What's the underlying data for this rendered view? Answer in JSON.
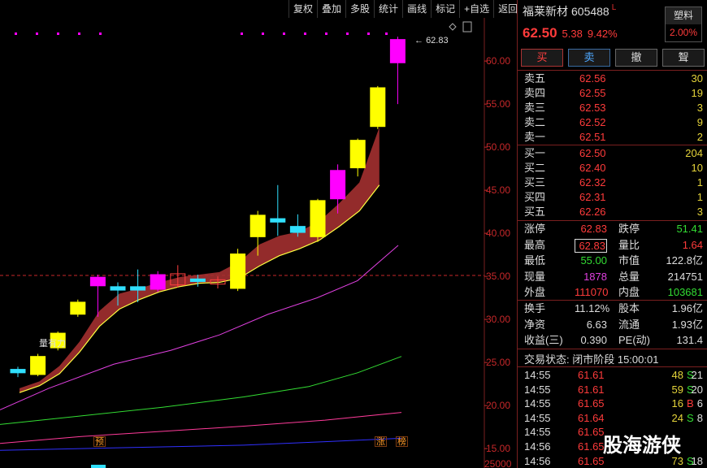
{
  "toolbar": [
    "复权",
    "叠加",
    "多股",
    "统计",
    "画线",
    "标记",
    "+自选",
    "返回"
  ],
  "stock": {
    "name": "福莱新材",
    "code": "605488",
    "flag": "L",
    "price": "62.50",
    "change": "5.38",
    "pct": "9.42%",
    "tag_top": "塑料",
    "tag_bottom": "2.00%"
  },
  "actions": [
    "买",
    "卖",
    "撤",
    "聟"
  ],
  "asks": [
    {
      "label": "卖五",
      "price": "62.56",
      "vol": "30"
    },
    {
      "label": "卖四",
      "price": "62.55",
      "vol": "19"
    },
    {
      "label": "卖三",
      "price": "62.53",
      "vol": "3"
    },
    {
      "label": "卖二",
      "price": "62.52",
      "vol": "9"
    },
    {
      "label": "卖一",
      "price": "62.51",
      "vol": "2"
    }
  ],
  "bids": [
    {
      "label": "买一",
      "price": "62.50",
      "vol": "204"
    },
    {
      "label": "买二",
      "price": "62.40",
      "vol": "10"
    },
    {
      "label": "买三",
      "price": "62.32",
      "vol": "1"
    },
    {
      "label": "买四",
      "price": "62.31",
      "vol": "1"
    },
    {
      "label": "买五",
      "price": "62.26",
      "vol": "3"
    }
  ],
  "quote1": [
    {
      "l1": "涨停",
      "v1": "62.83",
      "c1": "red",
      "l2": "跌停",
      "v2": "51.41",
      "c2": "green"
    },
    {
      "l1": "最高",
      "v1": "62.83",
      "c1": "red",
      "l2": "量比",
      "v2": "1.64",
      "c2": "red"
    },
    {
      "l1": "最低",
      "v1": "55.00",
      "c1": "green",
      "l2": "市值",
      "v2": "122.8亿",
      "c2": "white"
    },
    {
      "l1": "现量",
      "v1": "1878",
      "c1": "mag",
      "l2": "总量",
      "v2": "214751",
      "c2": "white"
    },
    {
      "l1": "外盘",
      "v1": "111070",
      "c1": "red",
      "l2": "内盘",
      "v2": "103681",
      "c2": "green"
    }
  ],
  "quote2": [
    {
      "l1": "换手",
      "v1": "11.12%",
      "l2": "股本",
      "v2": "1.96亿"
    },
    {
      "l1": "净资",
      "v1": "6.63",
      "l2": "流通",
      "v2": "1.93亿"
    },
    {
      "l1": "收益(三)",
      "v1": "0.390",
      "l2": "PE(动)",
      "v2": "131.4"
    }
  ],
  "status": "交易状态: 闭市阶段 15:00:01",
  "ticks": [
    {
      "time": "14:55",
      "price": "61.61",
      "vol": "48",
      "dir": "S",
      "cnt": "21"
    },
    {
      "time": "14:55",
      "price": "61.61",
      "vol": "59",
      "dir": "S",
      "cnt": "20"
    },
    {
      "time": "14:55",
      "price": "61.65",
      "vol": "16",
      "dir": "B",
      "cnt": "6"
    },
    {
      "time": "14:55",
      "price": "61.64",
      "vol": "24",
      "dir": "S",
      "cnt": "8"
    },
    {
      "time": "14:55",
      "price": "61.65",
      "vol": "",
      "dir": "",
      "cnt": ""
    },
    {
      "time": "14:56",
      "price": "61.65",
      "vol": "",
      "dir": "",
      "cnt": ""
    },
    {
      "time": "14:56",
      "price": "61.65",
      "vol": "73",
      "dir": "S",
      "cnt": "18"
    }
  ],
  "watermark": "股海游侠",
  "chart_data": {
    "type": "candlestick",
    "y_ticks": [
      "60.00",
      "55.00",
      "50.00",
      "45.00",
      "40.00",
      "35.00",
      "30.00",
      "25.00",
      "20.00",
      "15.00"
    ],
    "ylim": [
      13.5,
      64.2
    ],
    "dashed_level": 35.1,
    "max_label": "62.83",
    "indicator_label": "量有力",
    "markers": [
      "预",
      "涨",
      "榜"
    ],
    "bottom_label": "25000",
    "candles": [
      {
        "o": 23.8,
        "c": 24.2,
        "h": 24.5,
        "l": 23.3,
        "color": "#30e0ff"
      },
      {
        "o": 23.6,
        "c": 25.7,
        "h": 26.0,
        "l": 23.4,
        "color": "#ffff00"
      },
      {
        "o": 26.7,
        "c": 28.4,
        "h": 28.6,
        "l": 26.4,
        "color": "#ffff00"
      },
      {
        "o": 30.6,
        "c": 32.0,
        "h": 32.3,
        "l": 30.3,
        "color": "#ffff00"
      },
      {
        "o": 34.9,
        "c": 33.9,
        "h": 35.2,
        "l": 30.3,
        "color": "#ff00ff"
      },
      {
        "o": 33.8,
        "c": 33.4,
        "h": 34.3,
        "l": 31.6,
        "color": "#30e0ff"
      },
      {
        "o": 33.8,
        "c": 33.4,
        "h": 35.8,
        "l": 32.0,
        "color": "#30e0ff"
      },
      {
        "o": 35.2,
        "c": 33.5,
        "h": 35.6,
        "l": 33.2,
        "color": "#ff00ff"
      },
      {
        "o": 34.0,
        "c": 35.3,
        "h": 36.3,
        "l": 33.7,
        "color": "#ff4040",
        "hollow": true
      },
      {
        "o": 34.7,
        "c": 34.4,
        "h": 35.2,
        "l": 33.8,
        "color": "#30e0ff"
      },
      {
        "o": 34.6,
        "c": 34.1,
        "h": 35.0,
        "l": 33.6,
        "color": "#ff4040",
        "hollow": true
      },
      {
        "o": 33.6,
        "c": 37.6,
        "h": 38.2,
        "l": 33.3,
        "color": "#ffff00"
      },
      {
        "o": 39.6,
        "c": 42.1,
        "h": 42.6,
        "l": 37.4,
        "color": "#ffff00"
      },
      {
        "o": 41.7,
        "c": 41.3,
        "h": 45.6,
        "l": 39.7,
        "color": "#30e0ff"
      },
      {
        "o": 40.8,
        "c": 40.1,
        "h": 42.2,
        "l": 39.6,
        "color": "#30e0ff"
      },
      {
        "o": 39.6,
        "c": 43.8,
        "h": 44.0,
        "l": 39.0,
        "color": "#ffff00"
      },
      {
        "o": 44.0,
        "c": 47.3,
        "h": 48.0,
        "l": 42.3,
        "color": "#ff00ff"
      },
      {
        "o": 47.6,
        "c": 50.8,
        "h": 51.0,
        "l": 46.6,
        "color": "#ffff00"
      },
      {
        "o": 52.4,
        "c": 56.9,
        "h": 57.1,
        "l": 52.1,
        "color": "#ffff00"
      },
      {
        "o": 59.8,
        "c": 62.5,
        "h": 62.83,
        "l": 55.0,
        "color": "#ff00ff"
      }
    ],
    "ma_fast": [
      21.5,
      22.3,
      23.7,
      26.2,
      29.2,
      31.2,
      32.3,
      33.2,
      33.8,
      34.2,
      34.3,
      34.8,
      36.2,
      37.4,
      38.2,
      39.2,
      40.8,
      42.6,
      45.6
    ],
    "ma_fast2": [
      22.0,
      22.8,
      24.6,
      27.4,
      31.0,
      33.0,
      33.6,
      34.3,
      34.9,
      35.2,
      35.5,
      36.7,
      38.7,
      39.7,
      40.2,
      41.4,
      43.5,
      45.9,
      52.3
    ],
    "lines": [
      {
        "color": "#e040e0",
        "points": [
          [
            0,
            19.5
          ],
          [
            60,
            22.0
          ],
          [
            140,
            24.8
          ],
          [
            210,
            26.4
          ],
          [
            270,
            28.2
          ],
          [
            330,
            30.6
          ],
          [
            390,
            32.5
          ],
          [
            440,
            34.5
          ],
          [
            490,
            38.6
          ]
        ]
      },
      {
        "color": "#33dd33",
        "points": [
          [
            0,
            17.8
          ],
          [
            100,
            18.8
          ],
          [
            200,
            19.8
          ],
          [
            300,
            21.0
          ],
          [
            380,
            22.2
          ],
          [
            440,
            23.8
          ],
          [
            494,
            25.7
          ]
        ]
      },
      {
        "color": "#ff3b9a",
        "points": [
          [
            0,
            15.6
          ],
          [
            100,
            16.4
          ],
          [
            200,
            17.0
          ],
          [
            300,
            17.6
          ],
          [
            400,
            18.3
          ],
          [
            494,
            19.2
          ]
        ]
      },
      {
        "color": "#3030ff",
        "points": [
          [
            0,
            14.8
          ],
          [
            100,
            15.0
          ],
          [
            200,
            15.2
          ],
          [
            300,
            15.4
          ],
          [
            400,
            15.8
          ],
          [
            494,
            16.2
          ]
        ]
      }
    ]
  }
}
